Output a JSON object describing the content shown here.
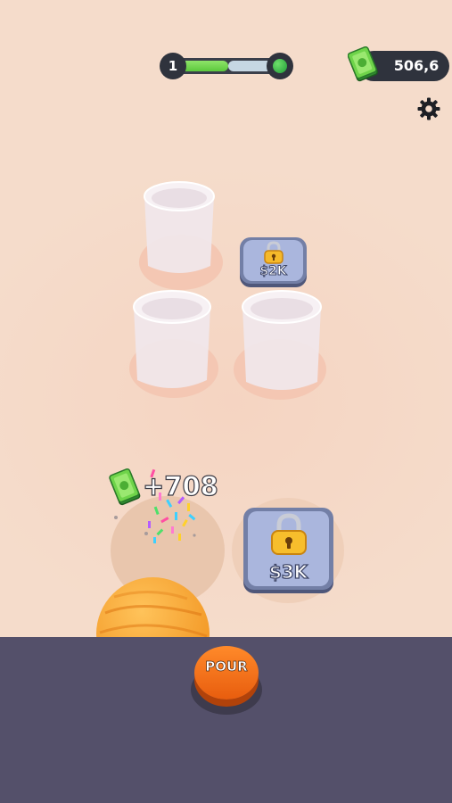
{
  "hud": {
    "level": "1",
    "level_progress": 0.52,
    "money": "506,6"
  },
  "icons": {
    "cash": "cash-stack-icon",
    "settings": "gear-icon",
    "lock": "padlock-icon",
    "next_level": "green-orb-icon"
  },
  "locks": {
    "small_price": "$2K",
    "large_price": "$3K"
  },
  "reward": {
    "amount": "+708"
  },
  "button": {
    "pour_label": "POUR"
  },
  "colors": {
    "background": "#f5dccb",
    "bottom_bar": "#54506a",
    "pour_button": "#f07218",
    "progress_fill": "#6fd94b",
    "lock_tile": "#8d99c4"
  }
}
